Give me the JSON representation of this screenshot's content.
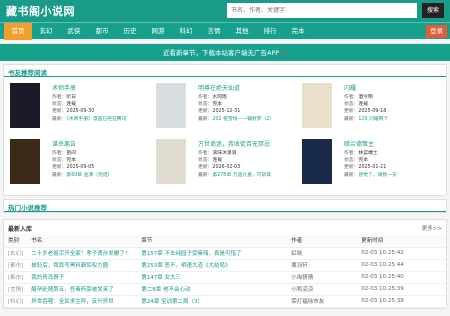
{
  "site": {
    "logo": "藏书阁小说网",
    "search_placeholder": "书名、作者、关键字",
    "search_button": "搜索"
  },
  "nav": {
    "items": [
      "首页",
      "玄幻",
      "武侠",
      "都市",
      "历史",
      "网游",
      "科幻",
      "言情",
      "其他",
      "排行",
      "完本"
    ],
    "login": "登录"
  },
  "notice": {
    "text": "近看新章节，下载本站客户端无广告APP",
    "hot": "!!!"
  },
  "recommend": {
    "title": "书友推荐阅读",
    "labels": {
      "author": "作者：",
      "status": "状态：",
      "update": "更新：",
      "latest": "最新："
    },
    "books": [
      {
        "title": "术师手册",
        "author": "听日",
        "status": "连载",
        "update": "2025-09-30",
        "latest": "《术师手册》漫画已经在腾讯",
        "cover": "#1a1a2a"
      },
      {
        "title": "明尊在绝天仙道",
        "author": "水阿雨",
        "status": "完本",
        "update": "2025-12-31",
        "latest": "202 枢雪线——镇封梦（2）",
        "cover": "#d8dde0"
      },
      {
        "title": "闪耀",
        "author": "酒今明",
        "status": "连载",
        "update": "2025-09-18",
        "latest": "120 闪耀网下",
        "cover": "#e8e0c8"
      },
      {
        "title": "谋杀离告",
        "author": "苗间",
        "status": "完本",
        "update": "2025-09-05",
        "latest": "第60章 查演（完结）",
        "cover": "#3a2a1a"
      },
      {
        "title": "万世诡迷，我收徒百无禁忌",
        "author": "滚味沐漢涧",
        "status": "连载",
        "update": "2026-02-03",
        "latest": "第278章 万道九重，可斩其",
        "cover": "#e0dcd0"
      },
      {
        "title": "暗兰德策主",
        "author": "林菜端士",
        "status": "完本",
        "update": "2025-01-21",
        "latest": "感觉了，请我一天",
        "cover": "#1a2a4a"
      }
    ]
  },
  "hot": {
    "title": "热门小说推荐"
  },
  "latest": {
    "title": "最新入库",
    "more": "更多>>",
    "headers": [
      "类别",
      "书名",
      "章节",
      "作者",
      "更新时间"
    ],
    "rows": [
      {
        "cat": "[玄幻]",
        "title": "二十岁老祖宗开全家！孝子贤孙发癫了！",
        "chapter": "第157章 不去纯园子受嘛嗨，真是可惜了",
        "author": "虹晓",
        "time": "02-03 10:25:42"
      },
      {
        "cat": "[都市]",
        "title": "被贬后，我靠写黑料霸惊权力圈",
        "chapter": "第253章 恶不，明速大道《大结局》",
        "author": "薰羽轩",
        "time": "02-03 10:25:44"
      },
      {
        "cat": "[都市]",
        "title": "我的青岛猴子",
        "chapter": "第147章 女大三",
        "author": "小淘猜猜",
        "time": "02-03 10:25:40"
      },
      {
        "cat": "[言情]",
        "title": "醒孕赴随赘五，吾毒药豪被发芙了",
        "chapter": "第二8章 他不会心动",
        "author": "小鸭涼涼",
        "time": "02-03 10:25:39"
      },
      {
        "cat": "[科幻]",
        "title": "异世吞噬：全民求生异，反升异世",
        "chapter": "第24章 宝训第二周（3）",
        "author": "荣灯福徐市友",
        "time": "02-03 10:25:39"
      }
    ]
  }
}
